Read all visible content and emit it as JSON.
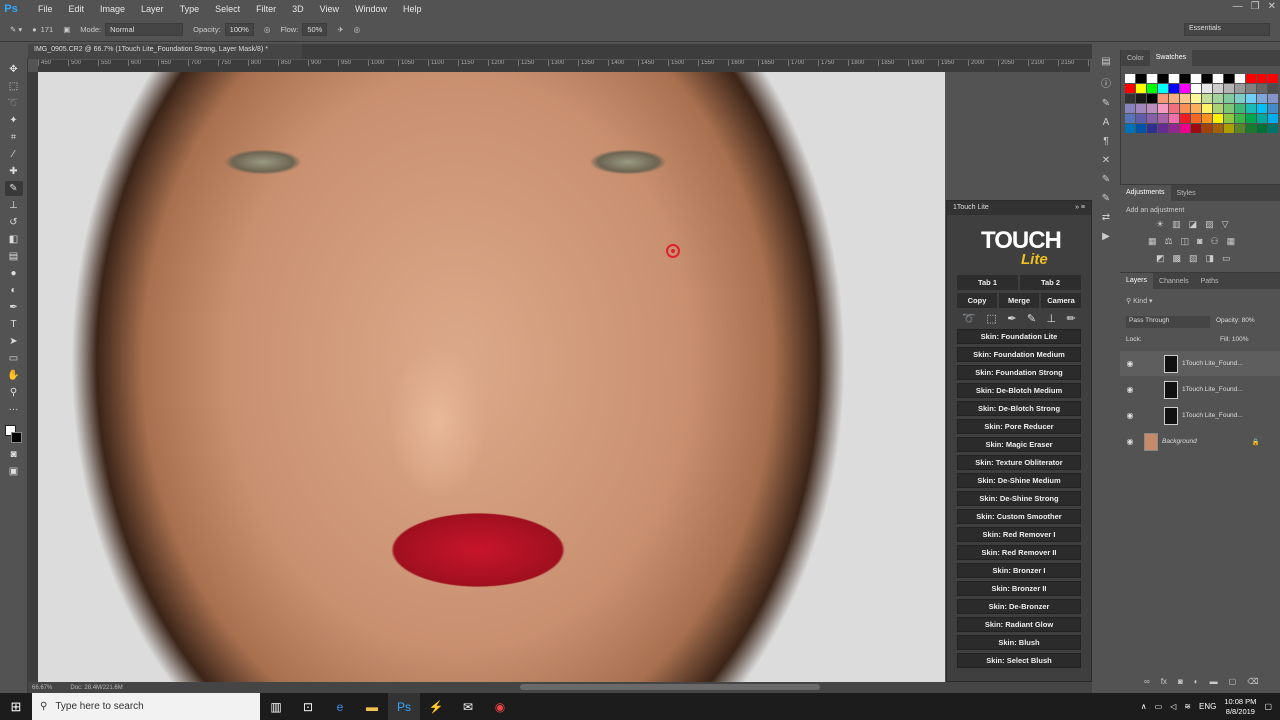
{
  "app": {
    "logo": "Ps"
  },
  "menu": [
    "File",
    "Edit",
    "Image",
    "Layer",
    "Type",
    "Select",
    "Filter",
    "3D",
    "View",
    "Window",
    "Help"
  ],
  "window_controls": [
    "—",
    "❐",
    "✕"
  ],
  "options": {
    "mode_label": "Mode:",
    "mode_value": "Normal",
    "opacity_label": "Opacity:",
    "opacity_value": "100%",
    "flow_label": "Flow:",
    "flow_value": "50%",
    "brush_size": "171"
  },
  "workspace": "Essentials",
  "document": {
    "tab_title": "IMG_0905.CR2 @ 66.7% (1Touch Lite_Foundation Strong, Layer Mask/8) *"
  },
  "ruler_ticks": [
    "450",
    "500",
    "550",
    "600",
    "650",
    "700",
    "750",
    "800",
    "850",
    "900",
    "950",
    "1000",
    "1050",
    "1100",
    "1150",
    "1200",
    "1250",
    "1300",
    "1350",
    "1400",
    "1450",
    "1500",
    "1550",
    "1600",
    "1650",
    "1700",
    "1750",
    "1800",
    "1850",
    "1900",
    "1950",
    "2000",
    "2050",
    "2100",
    "2150",
    "2200",
    "2250"
  ],
  "status": {
    "zoom": "66.67%",
    "doc": "Doc: 28.4M/221.6M"
  },
  "plugin": {
    "title": "1Touch Lite",
    "logo_main": "TOUCH",
    "logo_sub": "Lite",
    "tabs": [
      "Tab 1",
      "Tab 2"
    ],
    "actions": [
      "Copy",
      "Merge",
      "Camera"
    ],
    "skins": [
      "Skin: Foundation Lite",
      "Skin: Foundation Medium",
      "Skin: Foundation Strong",
      "Skin: De-Blotch Medium",
      "Skin: De-Blotch Strong",
      "Skin: Pore Reducer",
      "Skin: Magic Eraser",
      "Skin: Texture Obliterator",
      "Skin: De-Shine Medium",
      "Skin: De-Shine Strong",
      "Skin: Custom Smoother",
      "Skin: Red Remover I",
      "Skin: Red Remover II",
      "Skin: Bronzer I",
      "Skin: Bronzer II",
      "Skin: De-Bronzer",
      "Skin: Radiant Glow",
      "Skin: Blush",
      "Skin: Select Blush"
    ]
  },
  "swatches_panel": {
    "tabs": [
      "Color",
      "Swatches"
    ],
    "active": "Swatches"
  },
  "swatch_colors": [
    "#ffffff",
    "#000000",
    "#ffffff",
    "#000000",
    "#ffffff",
    "#000000",
    "#ffffff",
    "#000000",
    "#ffffff",
    "#000000",
    "#ffffff",
    "#ff0000",
    "#ff0000",
    "#ff0000",
    "#ff0000",
    "#ffff00",
    "#00ff00",
    "#00ffff",
    "#0000ff",
    "#ff00ff",
    "#ffffff",
    "#e6e6e6",
    "#cccccc",
    "#b3b3b3",
    "#999999",
    "#808080",
    "#666666",
    "#4d4d4d",
    "#333333",
    "#1a1a1a",
    "#000000",
    "#f7977a",
    "#f9ad81",
    "#fdc68a",
    "#fff79a",
    "#c4df9b",
    "#a2d39c",
    "#82ca9d",
    "#7bcdc8",
    "#6ecff6",
    "#7ea7d8",
    "#8493ca",
    "#8882be",
    "#a187be",
    "#bc8dbf",
    "#f49ac2",
    "#f26d7d",
    "#f68e55",
    "#fbaf5c",
    "#fff467",
    "#acd372",
    "#7cc576",
    "#3bb878",
    "#1abbb4",
    "#00bff3",
    "#438cca",
    "#5574b9",
    "#605ca8",
    "#855fa8",
    "#a763a8",
    "#f06eaa",
    "#ed1c24",
    "#f26522",
    "#f7941d",
    "#fff200",
    "#8dc73f",
    "#39b54a",
    "#00a651",
    "#00a99d",
    "#00aeef",
    "#0072bc",
    "#0054a6",
    "#2e3192",
    "#662d91",
    "#92278f",
    "#ec008c",
    "#9e0b0f",
    "#a0410d",
    "#a36209",
    "#aba000",
    "#598527",
    "#1a7b30",
    "#007236",
    "#00746b"
  ],
  "adjustments_panel": {
    "tabs": [
      "Adjustments",
      "Styles"
    ],
    "add_label": "Add an adjustment"
  },
  "layers_panel": {
    "tabs": [
      "Layers",
      "Channels",
      "Paths"
    ],
    "kind": "Kind",
    "blend": "Pass Through",
    "opacity_label": "Opacity:",
    "opacity": "80%",
    "lock_label": "Lock:",
    "fill_label": "Fill:",
    "fill": "100%",
    "layers": [
      {
        "name": "1Touch Lite_Found..."
      },
      {
        "name": "1Touch Lite_Found..."
      },
      {
        "name": "1Touch Lite_Found..."
      },
      {
        "name": "Background"
      }
    ]
  },
  "taskbar": {
    "search_placeholder": "Type here to search",
    "lang": "ENG",
    "time": "10:08 PM",
    "date": "8/8/2019"
  }
}
